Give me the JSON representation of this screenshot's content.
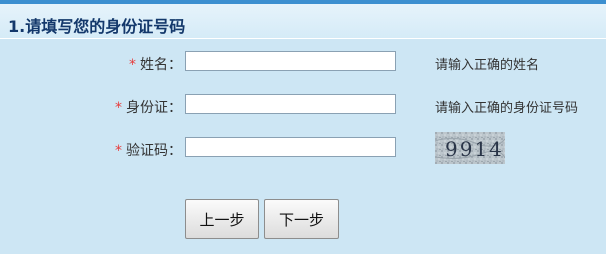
{
  "section": {
    "title": "1.请填写您的身份证号码"
  },
  "form": {
    "required_mark": "*",
    "fields": [
      {
        "label": "姓名：",
        "value": "",
        "hint": "请输入正确的姓名"
      },
      {
        "label": "身份证：",
        "value": "",
        "hint": "请输入正确的身份证号码"
      },
      {
        "label": "验证码：",
        "value": ""
      }
    ],
    "captcha": {
      "text": "9914",
      "icon": "captcha-image"
    }
  },
  "buttons": {
    "prev_label": "上一步",
    "next_label": "下一步"
  },
  "colors": {
    "background": "#cde6f4",
    "title": "#13386b",
    "required": "#e63c3c",
    "accent_strip": "#3c8fd0"
  }
}
